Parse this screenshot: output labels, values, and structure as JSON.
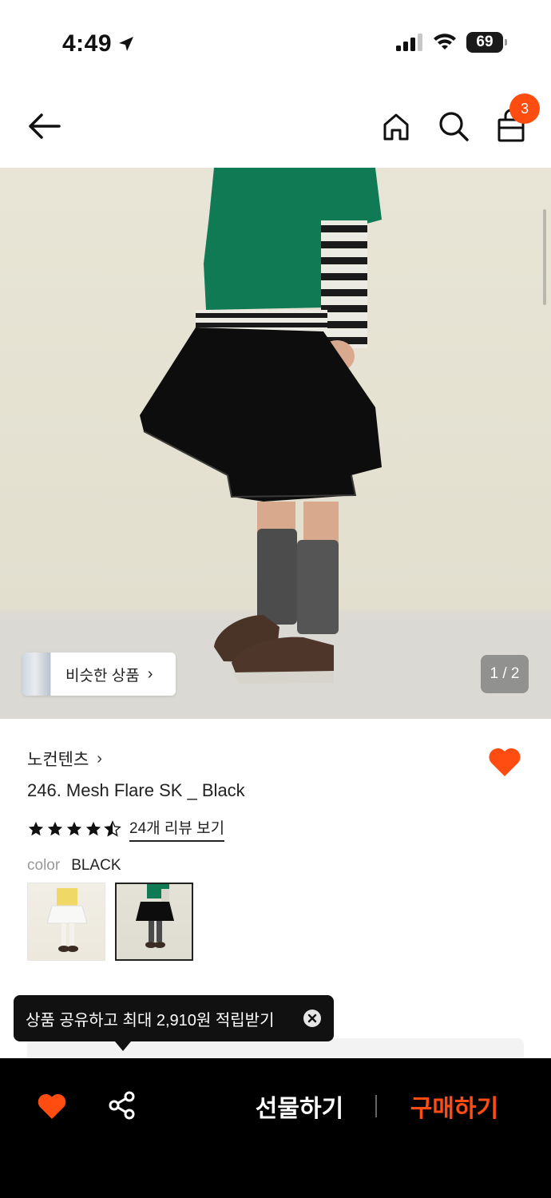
{
  "status_bar": {
    "time": "4:49",
    "battery": "69"
  },
  "nav": {
    "cart_count": "3",
    "icons": [
      "back-arrow-icon",
      "home-icon",
      "search-icon",
      "shopping-bag-icon"
    ]
  },
  "gallery": {
    "similar_label": "비슷한 상품",
    "page_indicator": "1 / 2"
  },
  "product": {
    "brand": "노컨텐츠",
    "title": "246. Mesh Flare SK _ Black",
    "rating": 4.5,
    "review_link": "24개 리뷰 보기",
    "color_label": "color",
    "color_value": "BLACK",
    "swatches": [
      "white",
      "black"
    ],
    "selected_swatch": "black"
  },
  "tooltip": {
    "text": "상품 공유하고 최대 2,910원 적립받기"
  },
  "bottom_bar": {
    "gift_label": "선물하기",
    "buy_label": "구매하기"
  },
  "colors": {
    "accent": "#ff4d12",
    "bottom_bar_bg": "#000000"
  }
}
